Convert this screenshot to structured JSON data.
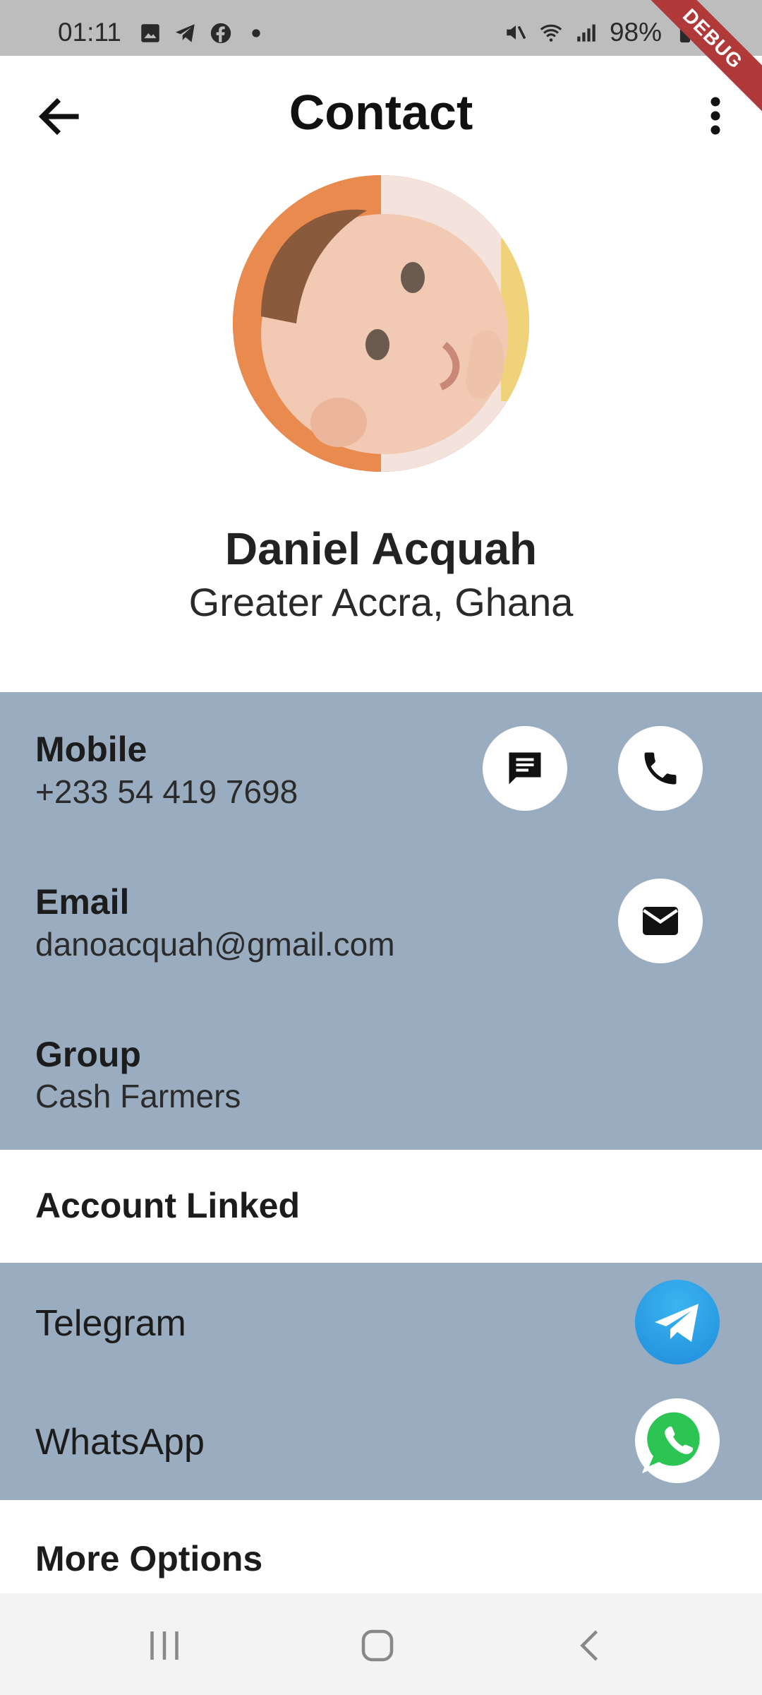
{
  "status_bar": {
    "time": "01:11",
    "battery": "98%",
    "left_icons": [
      "image-icon",
      "telegram-icon",
      "facebook-icon",
      "dot-icon"
    ],
    "right_icons": [
      "mute-icon",
      "wifi-icon",
      "signal-icon",
      "battery-icon"
    ]
  },
  "debug_banner": "DEBUG",
  "app_bar": {
    "title": "Contact",
    "back_icon": "arrow-back-icon",
    "menu_icon": "more-vert-icon"
  },
  "profile": {
    "name": "Daniel Acquah",
    "location": "Greater Accra, Ghana"
  },
  "contact_info": {
    "mobile_label": "Mobile",
    "mobile_value": "+233 54 419 7698",
    "email_label": "Email",
    "email_value": "danoacquah@gmail.com",
    "group_label": "Group",
    "group_value": "Cash Farmers"
  },
  "accounts": {
    "section_title": "Account Linked",
    "items": [
      {
        "label": "Telegram",
        "icon": "telegram-icon",
        "color": "#2aa3e6"
      },
      {
        "label": "WhatsApp",
        "icon": "whatsapp-icon",
        "color": "#2cc452"
      }
    ]
  },
  "more_options": {
    "section_title": "More Options"
  },
  "colors": {
    "panel": "#9aadc0",
    "status_bar": "#bdbdbd",
    "debug": "#b03a3a"
  }
}
